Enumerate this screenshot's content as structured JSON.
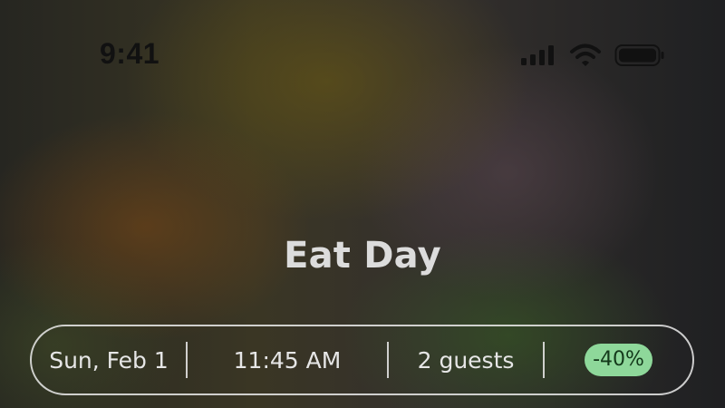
{
  "status_bar": {
    "time": "9:41",
    "icons": [
      "cellular-signal-icon",
      "wifi-icon",
      "battery-icon"
    ],
    "icon_color": "#111111"
  },
  "restaurant": {
    "name": "Eat Day"
  },
  "booking": {
    "date": "Sun, Feb 1",
    "time": "11:45 AM",
    "guests": "2 guests",
    "discount": "-40%",
    "discount_color": "#8ed89a"
  }
}
